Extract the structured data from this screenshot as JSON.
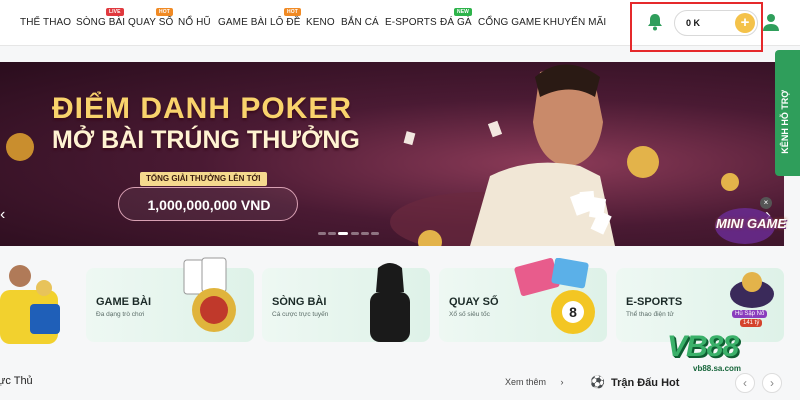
{
  "nav": {
    "items": [
      {
        "label": "THỂ THAO",
        "badge": ""
      },
      {
        "label": "SÒNG BÀI",
        "badge": "LIVE"
      },
      {
        "label": "QUAY SỐ",
        "badge": "HOT"
      },
      {
        "label": "NỔ HŨ",
        "badge": ""
      },
      {
        "label": "GAME BÀI",
        "badge": ""
      },
      {
        "label": "LÔ ĐỀ",
        "badge": "HOT"
      },
      {
        "label": "KENO",
        "badge": ""
      },
      {
        "label": "BẮN CÁ",
        "badge": ""
      },
      {
        "label": "E-SPORTS",
        "badge": ""
      },
      {
        "label": "ĐÁ GÀ",
        "badge": "NEW"
      },
      {
        "label": "CỔNG GAME",
        "badge": ""
      },
      {
        "label": "KHUYẾN MÃI",
        "badge": ""
      }
    ],
    "balance": "0 K",
    "add_icon": "plus-icon",
    "bell_icon": "bell-icon",
    "user_icon": "user-icon"
  },
  "banner": {
    "title_line1": "ĐIỂM DANH POKER",
    "title_line2": "MỞ BÀI TRÚNG THƯỞNG",
    "prize_label": "TỔNG GIẢI THƯỞNG LÊN TỚI",
    "prize_value": "1,000,000,000 VND"
  },
  "support": {
    "label": "KÊNH HỖ TRỢ"
  },
  "cards": [
    {
      "title": "GAME BÀI",
      "subtitle": "Đa dạng trò chơi"
    },
    {
      "title": "SÒNG BÀI",
      "subtitle": "Cá cược trực tuyến"
    },
    {
      "title": "QUAY SỐ",
      "subtitle": "Xổ số siêu tốc"
    },
    {
      "title": "E-SPORTS",
      "subtitle": "Thể thao điện tử"
    }
  ],
  "bottom": {
    "left_heading": "ực Thủ",
    "see_more": "Xem thêm",
    "hot_matches": "Trận Đấu Hot"
  },
  "minigame": {
    "label": "MINI GAME"
  },
  "jackpot": {
    "label": "Hũ Sập Nổ",
    "value": "141 tỷ"
  },
  "brand": {
    "logo": "VB88",
    "url": "vb88.sa.com"
  },
  "colors": {
    "accent": "#2f9e5b",
    "highlight": "#e5292b",
    "gold": "#f4c24a"
  }
}
